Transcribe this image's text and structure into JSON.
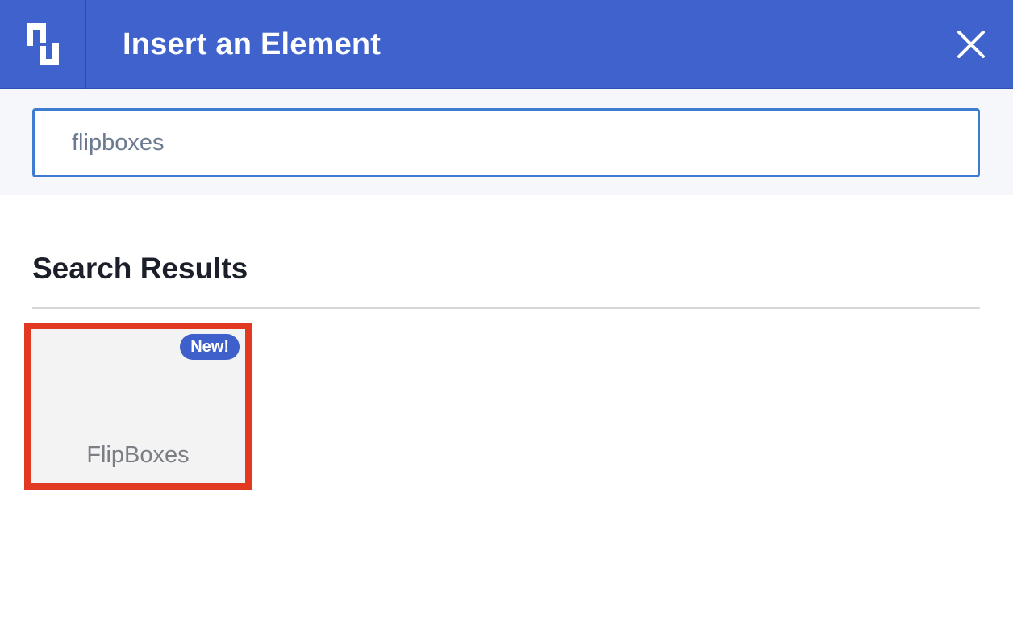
{
  "header": {
    "logo_icon": "bracket-logo-icon",
    "title": "Insert an Element",
    "close_icon": "close-icon",
    "background": "#3f62cc"
  },
  "search": {
    "value": "flipboxes",
    "focus_color": "#3f7bd0"
  },
  "results": {
    "heading": "Search Results",
    "items": [
      {
        "label": "FlipBoxes",
        "badge": "New!",
        "highlight_color": "#e23a22",
        "badge_color": "#3f5fcb"
      }
    ]
  }
}
